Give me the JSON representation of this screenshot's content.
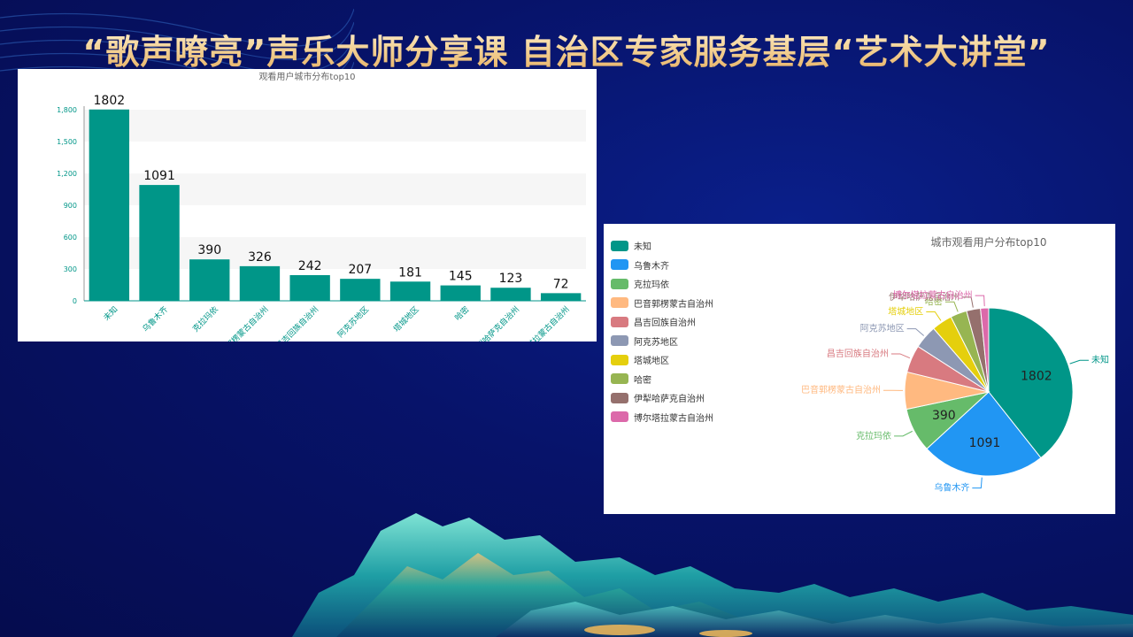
{
  "slide": {
    "title": "“歌声嘹亮”声乐大师分享课  自治区专家服务基层“艺术大讲堂”"
  },
  "colors": {
    "bar": "#009688",
    "bar_axis_text": "#009688",
    "title_gold": "#f3d49a"
  },
  "chart_data": [
    {
      "type": "bar",
      "title": "观看用户城市分布top10",
      "categories": [
        "未知",
        "乌鲁木齐",
        "克拉玛依",
        "巴音郭楞蒙古自治州",
        "昌吉回族自治州",
        "阿克苏地区",
        "塔城地区",
        "哈密",
        "伊犁哈萨克自治州",
        "博尔塔拉蒙古自治州"
      ],
      "values": [
        1802,
        1091,
        390,
        326,
        242,
        207,
        181,
        145,
        123,
        72
      ],
      "ylim": [
        0,
        1800
      ],
      "yticks": [
        0,
        300,
        600,
        900,
        1200,
        1500,
        1800
      ],
      "ytick_labels": [
        "0",
        "300",
        "600",
        "900",
        "1,200",
        "1,500",
        "1,800"
      ],
      "grid": "alternating horizontal bands",
      "data_labels": true
    },
    {
      "type": "pie",
      "title": "城市观看用户分布top10",
      "legend_position": "left",
      "labels": [
        "未知",
        "乌鲁木齐",
        "克拉玛依",
        "巴音郭楞蒙古自治州",
        "昌吉回族自治州",
        "阿克苏地区",
        "塔城地区",
        "哈密",
        "伊犁哈萨克自治州",
        "博尔塔拉蒙古自治州"
      ],
      "values": [
        1802,
        1091,
        390,
        326,
        242,
        207,
        181,
        145,
        123,
        72
      ],
      "colors": [
        "#009688",
        "#2196f3",
        "#66bb6a",
        "#ffb980",
        "#d87a80",
        "#8d98b3",
        "#e5cf0d",
        "#97b552",
        "#95706d",
        "#dc69aa"
      ],
      "slice_value_labels": [
        "1802",
        "1091",
        "390"
      ]
    }
  ]
}
